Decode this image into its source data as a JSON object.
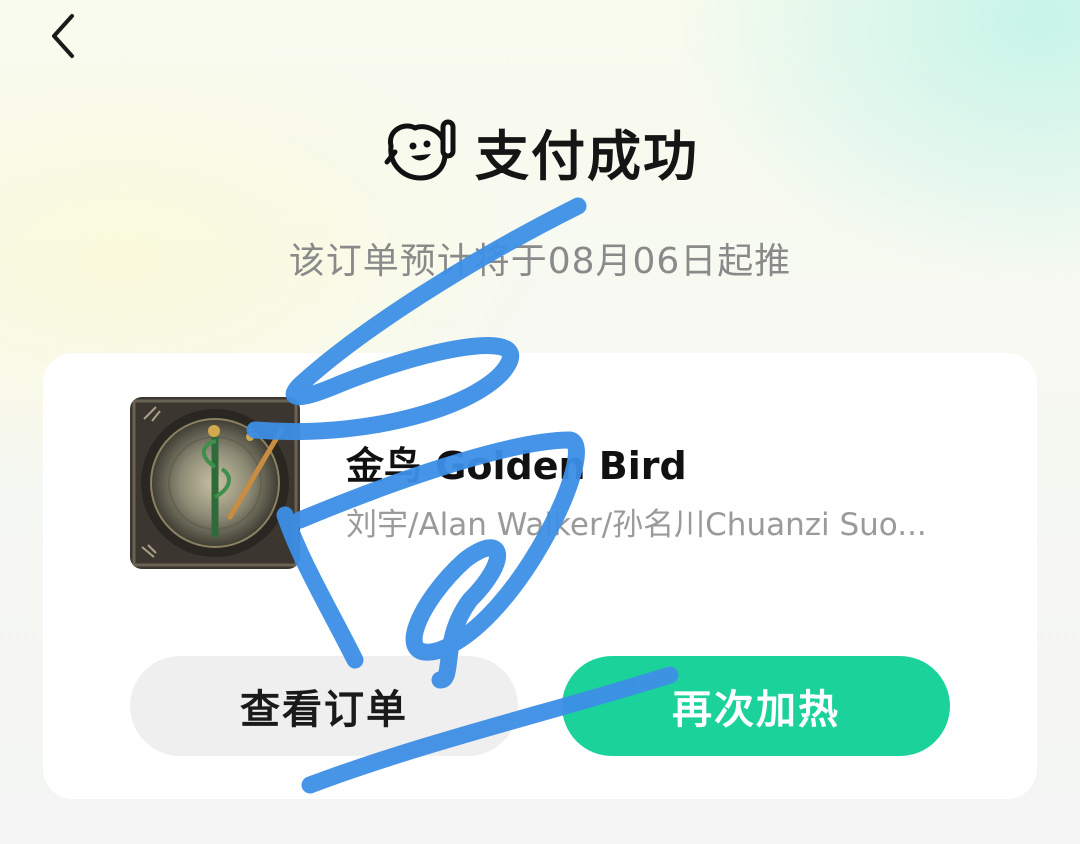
{
  "header": {
    "back_icon": "chevron-left-icon"
  },
  "status": {
    "title": "支付成功",
    "icon": "mascot-waving-icon",
    "subtitle": "该订单预计将于08月06日起推"
  },
  "order": {
    "cover_icon": "album-cover",
    "song_title": "金鸟 Golden Bird",
    "artist": "刘宇/Alan Walker/孙名川Chuanzi Suo...",
    "buttons": {
      "view_order": "查看订单",
      "reheat": "再次加热"
    }
  },
  "colors": {
    "accent": "#1bd39a",
    "annotation": "#3d8fe6",
    "title_text": "#151515",
    "secondary_text": "#8a8a8a"
  }
}
